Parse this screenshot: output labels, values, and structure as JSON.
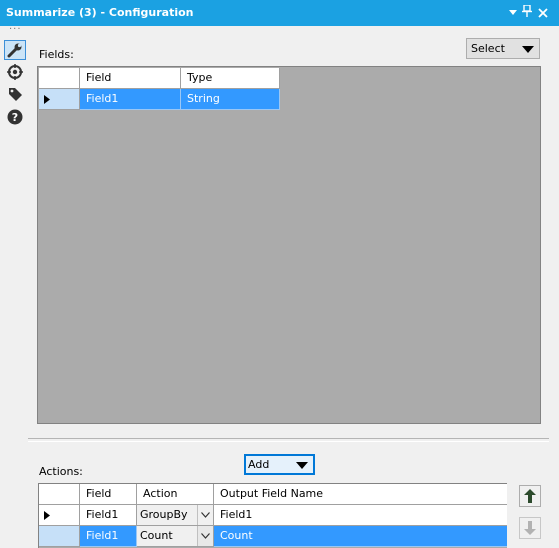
{
  "window": {
    "title": "Summarize (3) - Configuration",
    "controls": [
      "chevron-down-icon",
      "pin-icon",
      "close-icon"
    ]
  },
  "sidebar": {
    "items": [
      {
        "icon": "wrench-icon",
        "active": true
      },
      {
        "icon": "target-icon",
        "active": false
      },
      {
        "icon": "tag-icon",
        "active": false
      },
      {
        "icon": "help-icon",
        "active": false
      }
    ]
  },
  "fields_section": {
    "label": "Fields:",
    "select_label": "Select",
    "columns": [
      "Field",
      "Type"
    ],
    "rows": [
      {
        "field": "Field1",
        "type": "String",
        "selected": true
      }
    ]
  },
  "actions_section": {
    "label": "Actions:",
    "add_label": "Add",
    "columns": [
      "Field",
      "Action",
      "Output Field Name"
    ],
    "rows": [
      {
        "field": "Field1",
        "action": "GroupBy",
        "output": "Field1",
        "selected": false
      },
      {
        "field": "Field1",
        "action": "Count",
        "output": "Count",
        "selected": true
      }
    ]
  },
  "colors": {
    "titlebar": "#1ba1e2",
    "selection": "#3399ff",
    "grid_background": "#ababab"
  }
}
